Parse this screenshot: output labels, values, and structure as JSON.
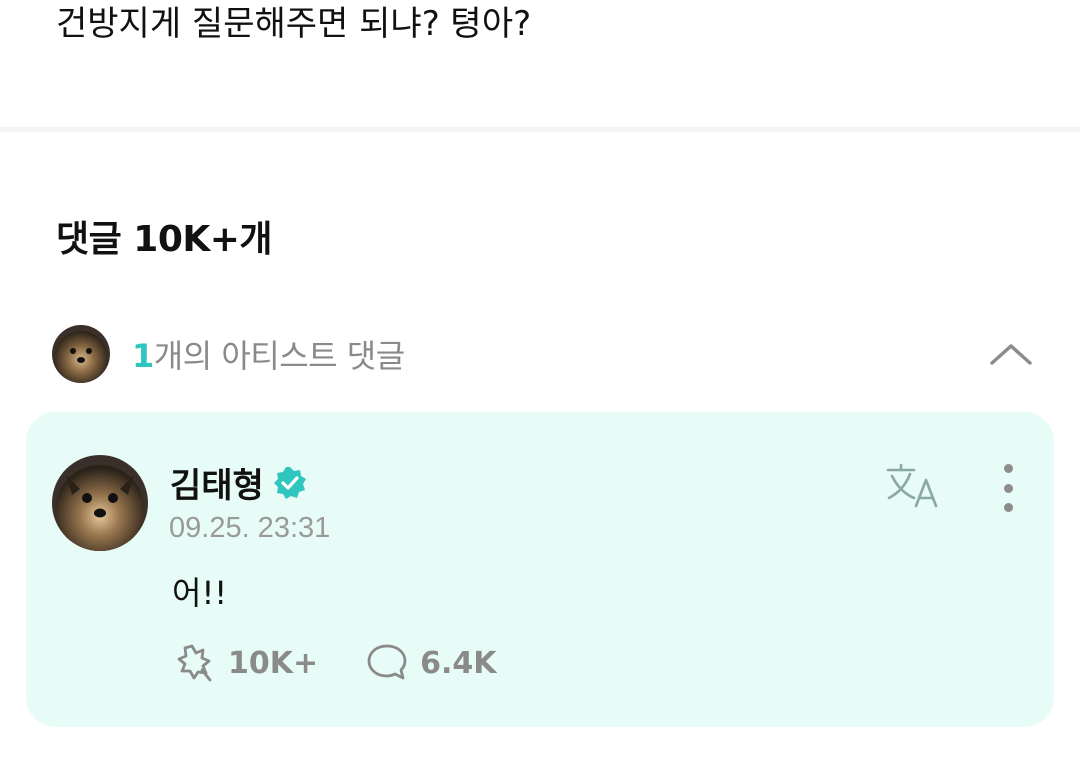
{
  "post": {
    "text": "건방지게 질문해주면 되냐? 텽아?"
  },
  "comments": {
    "header": "댓글 10K+개"
  },
  "artist_comments": {
    "count": "1",
    "label": "개의 아티스트 댓글"
  },
  "comment": {
    "author": "김태형",
    "timestamp": "09.25. 23:31",
    "body": "어!!",
    "likes": "10K+",
    "replies": "6.4K"
  },
  "colors": {
    "accent": "#2fc6bf",
    "card_bg": "#e7fbf7",
    "muted_text": "#8a8a8a"
  },
  "icons": {
    "collapse": "chevron-up-icon",
    "verified": "verified-badge-icon",
    "translate": "translate-icon",
    "more": "more-vertical-icon",
    "like": "like-icon",
    "reply": "reply-bubble-icon"
  }
}
